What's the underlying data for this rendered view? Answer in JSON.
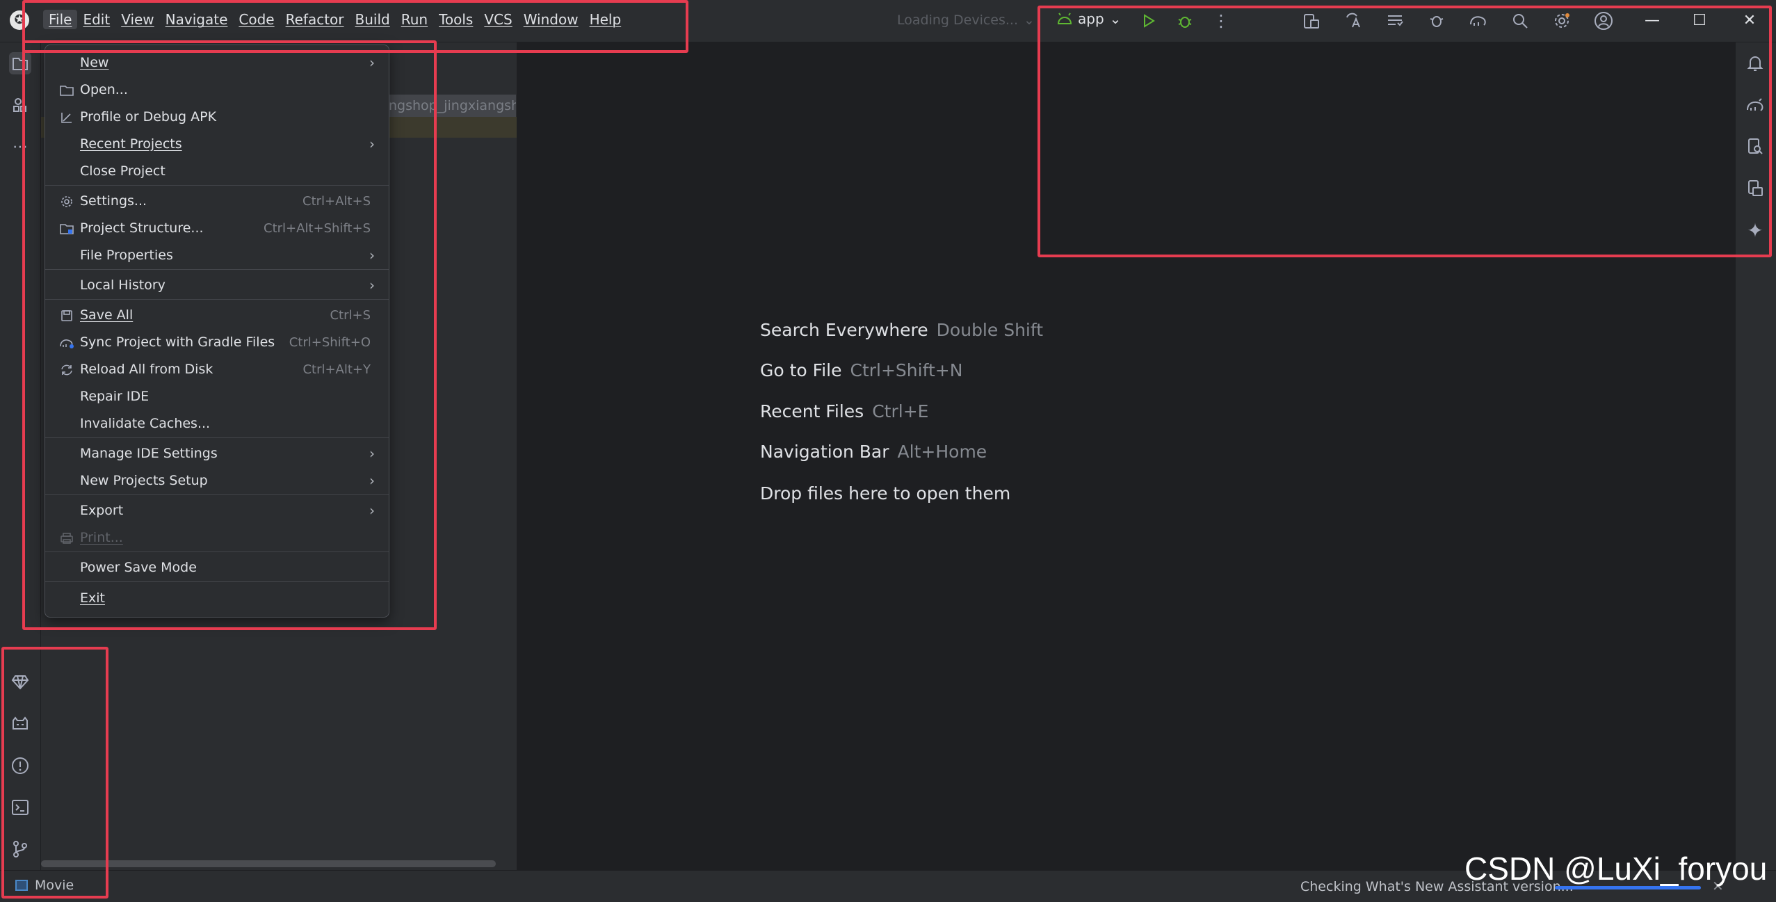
{
  "menubar": {
    "items": [
      "File",
      "Edit",
      "View",
      "Navigate",
      "Code",
      "Refactor",
      "Build",
      "Run",
      "Tools",
      "VCS",
      "Window",
      "Help"
    ]
  },
  "toolbar": {
    "device_selector": "Loading Devices...",
    "run_config": "app"
  },
  "file_menu": {
    "items": [
      {
        "label": "New",
        "shortcut": "",
        "arrow": "›",
        "icon": ""
      },
      {
        "label": "Open...",
        "shortcut": "",
        "arrow": "",
        "icon": "folder-icon"
      },
      {
        "label": "Profile or Debug APK",
        "shortcut": "",
        "arrow": "",
        "icon": "import-arrow-icon"
      },
      {
        "label": "Recent Projects",
        "shortcut": "",
        "arrow": "›",
        "icon": ""
      },
      {
        "label": "Close Project",
        "shortcut": "",
        "arrow": "",
        "icon": ""
      },
      {
        "label": "Settings...",
        "shortcut": "Ctrl+Alt+S",
        "arrow": "",
        "icon": "gear-icon"
      },
      {
        "label": "Project Structure...",
        "shortcut": "Ctrl+Alt+Shift+S",
        "arrow": "",
        "icon": "project-structure-icon"
      },
      {
        "label": "File Properties",
        "shortcut": "",
        "arrow": "›",
        "icon": ""
      },
      {
        "label": "Local History",
        "shortcut": "",
        "arrow": "›",
        "icon": ""
      },
      {
        "label": "Save All",
        "shortcut": "Ctrl+S",
        "arrow": "",
        "icon": "save-icon"
      },
      {
        "label": "Sync Project with Gradle Files",
        "shortcut": "Ctrl+Shift+O",
        "arrow": "",
        "icon": "gradle-sync-icon"
      },
      {
        "label": "Reload All from Disk",
        "shortcut": "Ctrl+Alt+Y",
        "arrow": "",
        "icon": "reload-icon"
      },
      {
        "label": "Repair IDE",
        "shortcut": "",
        "arrow": "",
        "icon": ""
      },
      {
        "label": "Invalidate Caches...",
        "shortcut": "",
        "arrow": "",
        "icon": ""
      },
      {
        "label": "Manage IDE Settings",
        "shortcut": "",
        "arrow": "›",
        "icon": ""
      },
      {
        "label": "New Projects Setup",
        "shortcut": "",
        "arrow": "›",
        "icon": ""
      },
      {
        "label": "Export",
        "shortcut": "",
        "arrow": "›",
        "icon": ""
      },
      {
        "label": "Print...",
        "shortcut": "",
        "arrow": "",
        "icon": "print-icon",
        "disabled": true
      },
      {
        "label": "Power Save Mode",
        "shortcut": "",
        "arrow": "",
        "icon": ""
      },
      {
        "label": "Exit",
        "shortcut": "",
        "arrow": "",
        "icon": ""
      }
    ]
  },
  "project_panel": {
    "path_fragment": "ngshop_jingxiangshop"
  },
  "editor_hints": [
    {
      "action": "Search Everywhere",
      "shortcut": "Double Shift"
    },
    {
      "action": "Go to File",
      "shortcut": "Ctrl+Shift+N"
    },
    {
      "action": "Recent Files",
      "shortcut": "Ctrl+E"
    },
    {
      "action": "Navigation Bar",
      "shortcut": "Alt+Home"
    },
    {
      "action": "Drop files here to open them",
      "shortcut": ""
    }
  ],
  "statusbar": {
    "project_name": "Movie",
    "message": "Checking What's New Assistant version...",
    "close_glyph": "✕"
  },
  "watermark": "CSDN @LuXi_foryou",
  "window_controls": {
    "minimize": "—",
    "maximize": "☐",
    "close": "✕"
  },
  "colors": {
    "accent": "#3574f0",
    "annotation": "#e63c50",
    "run_green": "#5fb832"
  }
}
